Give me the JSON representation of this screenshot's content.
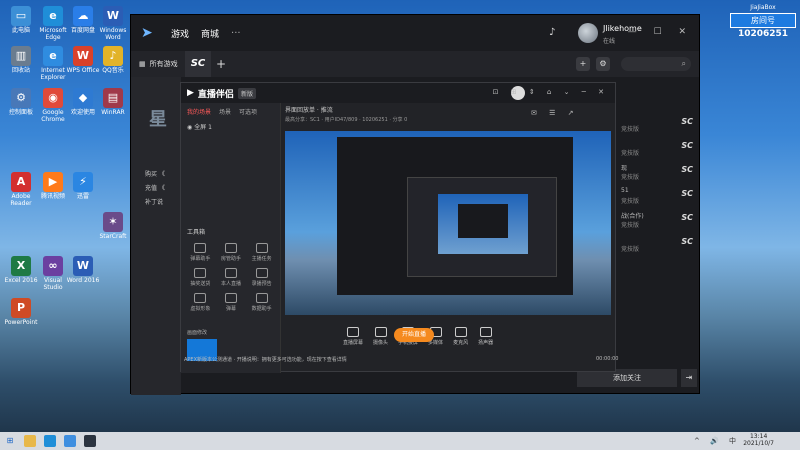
{
  "desktop_icons": [
    {
      "label": "此电脑",
      "glyph": "▭",
      "color": "#3c8fd6"
    },
    {
      "label": "Microsoft Edge",
      "glyph": "e",
      "color": "#1f8ed8"
    },
    {
      "label": "百度网盘",
      "glyph": "☁",
      "color": "#2a7ee8"
    },
    {
      "label": "Windows Word",
      "glyph": "W",
      "color": "#2b5db5"
    },
    {
      "label": "回收站",
      "glyph": "🗑",
      "color": "#6a7c8f"
    },
    {
      "label": "Internet Explorer",
      "glyph": "e",
      "color": "#2f8ce0"
    },
    {
      "label": "WPS Office",
      "glyph": "W",
      "color": "#d9412a"
    },
    {
      "label": "QQ音乐",
      "glyph": "♪",
      "color": "#e2b329"
    },
    {
      "label": "控制面板",
      "glyph": "⚙",
      "color": "#4878b8"
    },
    {
      "label": "Google Chrome",
      "glyph": "◉",
      "color": "#e04a3a"
    },
    {
      "label": "欢迎使用",
      "glyph": "◆",
      "color": "#2e7ad2"
    },
    {
      "label": "WinRAR",
      "glyph": "▤",
      "color": "#a0394a"
    },
    {
      "label": "Adobe Reader",
      "glyph": "A",
      "color": "#d32f2f"
    },
    {
      "label": "腾讯视频",
      "glyph": "▶",
      "color": "#ff7a1a"
    },
    {
      "label": "迅雷",
      "glyph": "⚡",
      "color": "#2b86e2"
    },
    {
      "label": "StarCraft",
      "glyph": "✶",
      "color": "#6a4b8a"
    },
    {
      "label": "Excel 2016",
      "glyph": "X",
      "color": "#1e7a45"
    },
    {
      "label": "Visual Studio",
      "glyph": "∞",
      "color": "#6b3fa0"
    },
    {
      "label": "Word 2016",
      "glyph": "W",
      "color": "#2b5db5"
    },
    {
      "label": "PowerPoint",
      "glyph": "P",
      "color": "#cf4b25"
    }
  ],
  "tray_logo": {
    "brand": "JiaJiaBox",
    "room_label": "房间号",
    "room_number": "10206251"
  },
  "app": {
    "nav_game": "游戏",
    "nav_store": "商城",
    "more": "···",
    "username": "Jlikehome",
    "status": "在线",
    "window_controls": "— ☐ ✕",
    "tab_all": "所有游戏",
    "tab_sc": "SC",
    "tab_add": "+",
    "search_icon_glyph": "⌕",
    "left_char": "星",
    "left_row1": "购买 《",
    "left_row2": "充值 《",
    "left_row3": "补丁说",
    "right_list": [
      {
        "title": "",
        "sub": "竞技版",
        "sc": "SC"
      },
      {
        "title": "",
        "sub": "竞技版",
        "sc": "SC"
      },
      {
        "title": "现",
        "sub": "竞技版",
        "sc": "SC"
      },
      {
        "title": "51",
        "sub": "竞技版",
        "sc": "SC"
      },
      {
        "title": "战(合作)",
        "sub": "竞技版",
        "sc": "SC"
      },
      {
        "title": "",
        "sub": "竞技版",
        "sc": "SC"
      }
    ],
    "follow_button": "添加关注",
    "exit_glyph": "⇥"
  },
  "companion": {
    "brand": "直播伴侣",
    "version": "新版",
    "window_controls": "⊡ ⊞ ⇕ ⌂ ⌄ ─ ✕",
    "tabs": [
      "我的场景",
      "场景",
      "可选项"
    ],
    "scene_name": "全屏 1",
    "header": "界面回放单 · 推流",
    "sub": "最高分享：SC1 · 用户ID47/809 · 10206251 · 分享 0",
    "header_icons": "✉ ☰ ↗",
    "tool_title": "工具箱",
    "tools": [
      "弹幕助手",
      "房管助手",
      "主播任务",
      "抽奖送货",
      "本人直播",
      "录播预告",
      "虚拟形象",
      "弹幕",
      "数据助手",
      "",
      "",
      ""
    ],
    "source_title": "画面修改",
    "bottom_buttons": [
      "直播屏幕",
      "摄像头",
      "手机投屏",
      "多媒体",
      "麦克风",
      "扬声器"
    ],
    "start_live": "开始直播",
    "notice": "APEX新版本公测通道 · 开播说明：拥有更多可选功能，现在按下查看详情",
    "timer": "00:00:00"
  },
  "taskbar": {
    "start_glyph": "⊞",
    "clock_time": "13:14",
    "clock_date": "2021/10/7",
    "tray": "^ 🔊 中"
  }
}
